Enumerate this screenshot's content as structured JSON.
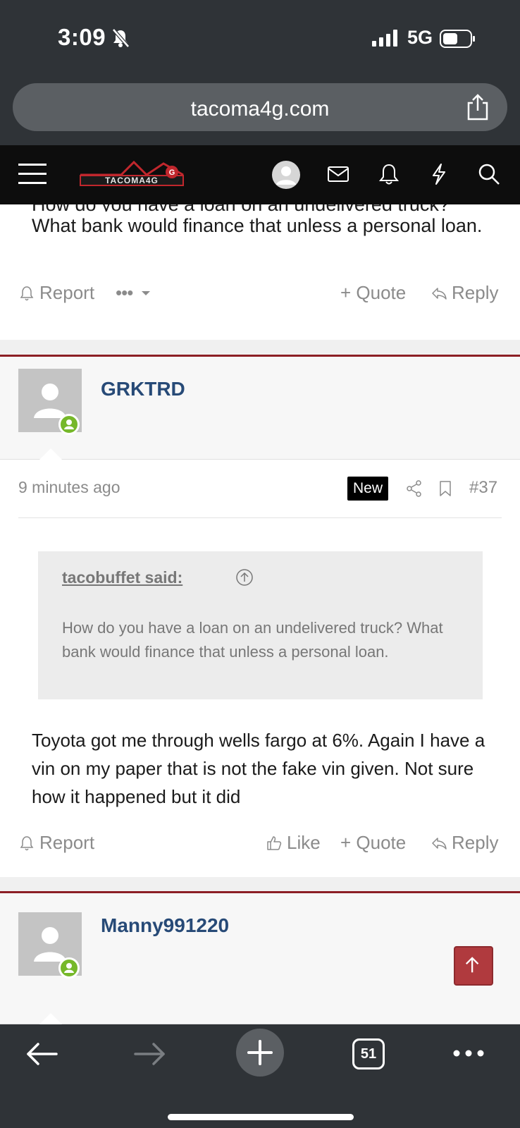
{
  "status_bar": {
    "time": "3:09",
    "network": "5G"
  },
  "browser": {
    "url": "tacoma4g.com",
    "tabs_count": "51"
  },
  "site": {
    "logo_text": "TACOMA4G"
  },
  "previous_post": {
    "text_cut": "How do you have a loan on an undelivered truck?",
    "text": "What bank would finance that unless a personal loan.",
    "actions": {
      "report": "Report",
      "quote": "+ Quote",
      "reply": "Reply"
    }
  },
  "post_37": {
    "username": "GRKTRD",
    "time": "9 minutes ago",
    "badge": "New",
    "number": "#37",
    "quote_author": "tacobuffet said:",
    "quote_text": "How do you have a loan on an undelivered truck? What bank would finance that unless a personal loan.",
    "message": "Toyota got me through wells fargo at 6%. Again I have a vin on my paper that is not the fake vin given. Not sure how it happened but it did",
    "actions": {
      "report": "Report",
      "like": "Like",
      "quote": "+ Quote",
      "reply": "Reply"
    }
  },
  "next_post": {
    "username": "Manny991220"
  },
  "colors": {
    "accent": "#8c1f25",
    "username": "#274a77",
    "online": "#76b82a"
  }
}
